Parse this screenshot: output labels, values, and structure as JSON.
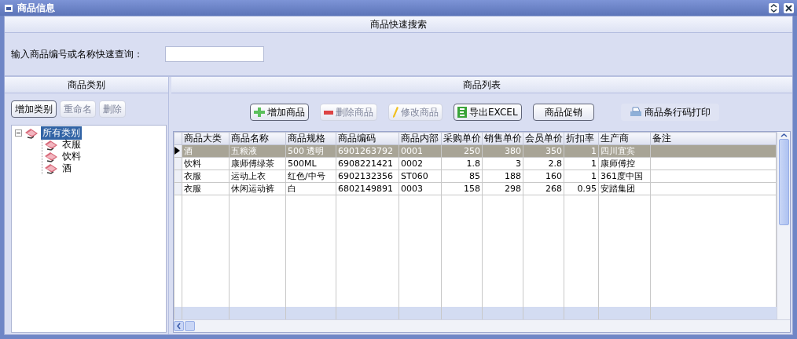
{
  "window": {
    "title": "商品信息"
  },
  "search": {
    "header": "商品快速搜索",
    "label": "输入商品编号或名称快速查询："
  },
  "category_panel": {
    "header": "商品类别",
    "buttons": [
      {
        "label": "增加类别",
        "disabled": false
      },
      {
        "label": "重命名",
        "disabled": true
      },
      {
        "label": "删除",
        "disabled": true
      }
    ],
    "tree": [
      {
        "label": "所有类别",
        "selected": true,
        "expanded": true,
        "children": [
          {
            "label": "衣服",
            "selected": false
          },
          {
            "label": "饮料",
            "selected": false
          },
          {
            "label": "酒",
            "selected": false
          }
        ]
      }
    ]
  },
  "product_panel": {
    "header": "商品列表",
    "toolbar": [
      {
        "label": "增加商品",
        "kind": "add",
        "disabled": false
      },
      {
        "label": "删除商品",
        "kind": "delete",
        "disabled": true
      },
      {
        "label": "修改商品",
        "kind": "edit",
        "disabled": true
      },
      {
        "label": "导出EXCEL",
        "kind": "excel",
        "disabled": false
      },
      {
        "label": "商品促销",
        "kind": "plain",
        "disabled": false
      },
      {
        "label": "商品条行码打印",
        "kind": "print",
        "disabled": false
      }
    ],
    "table": {
      "columns": [
        "商品大类",
        "商品名称",
        "商品规格",
        "商品编码",
        "商品内部",
        "采购单价",
        "销售单价",
        "会员单价",
        "折扣率",
        "生产商",
        "备注"
      ],
      "rows": [
        {
          "selected": true,
          "cells": [
            "酒",
            "五粮液",
            "500 透明",
            "6901263792",
            "0001",
            "250",
            "380",
            "350",
            "1",
            "四川宜宾",
            ""
          ]
        },
        {
          "selected": false,
          "cells": [
            "饮料",
            "康师傅绿茶",
            "500ML",
            "6908221421",
            "0002",
            "1.8",
            "3",
            "2.8",
            "1",
            "康师傅控",
            ""
          ]
        },
        {
          "selected": false,
          "cells": [
            "衣服",
            "运动上衣",
            "红色/中号",
            "6902132356",
            "ST060",
            "85",
            "188",
            "160",
            "1",
            "361度中国",
            ""
          ]
        },
        {
          "selected": false,
          "cells": [
            "衣服",
            "休闲运动裤",
            "白",
            "6802149891",
            "0003",
            "158",
            "298",
            "268",
            "0.95",
            "安踏集团",
            ""
          ]
        }
      ]
    }
  }
}
